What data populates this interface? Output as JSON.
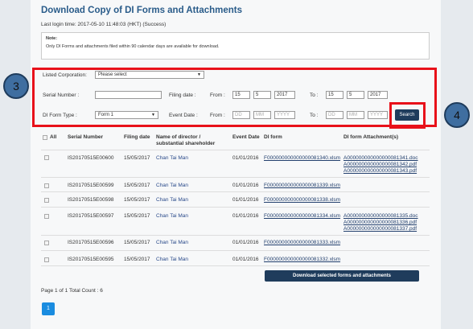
{
  "header": {
    "title": "Download Copy of DI Forms and Attachments",
    "last_login": "Last login time: 2017-05-10 11:48:03 (HKT) (Success)"
  },
  "note": {
    "label": "Note:",
    "text": "Only DI Forms and attachments filed within 90 calendar days are available for download."
  },
  "search_form": {
    "listed_corporation_label": "Listed Corporation:",
    "listed_corporation_value": "Please select",
    "serial_number_label": "Serial Number :",
    "serial_number_value": "",
    "filing_date_label": "Filing date :",
    "from_label": "From :",
    "to_label": "To :",
    "filing_from": {
      "dd": "15",
      "mm": "5",
      "yyyy": "2017"
    },
    "filing_to": {
      "dd": "15",
      "mm": "5",
      "yyyy": "2017"
    },
    "di_form_type_label": "DI Form Type :",
    "di_form_type_value": "Form 1",
    "event_date_label": "Event Date :",
    "event_from": {
      "dd": "DD",
      "mm": "MM",
      "yyyy": "YYYY"
    },
    "event_to": {
      "dd": "DD",
      "mm": "MM",
      "yyyy": "YYYY"
    },
    "search_button": "Search"
  },
  "callouts": {
    "c3": "3",
    "c4": "4"
  },
  "table": {
    "headers": {
      "all": "All",
      "serial": "Serial Number",
      "filing_date": "Filing date",
      "director": "Name of director / substantial shareholder",
      "event_date": "Event Date",
      "di_form": "DI form",
      "attachments": "DI form Attachment(s)"
    },
    "rows": [
      {
        "serial": "IS20170515E00600",
        "filing_date": "15/05/2017",
        "name": "Chan Tai Man",
        "event_date": "01/01/2016",
        "di_form": "F000000000000000081340.xlsm",
        "attachments": [
          "A000000000000000081341.doc",
          "A000000000000000081342.pdf",
          "A000000000000000081343.pdf"
        ]
      },
      {
        "serial": "IS20170515E00599",
        "filing_date": "15/05/2017",
        "name": "Chan Tai Man",
        "event_date": "01/01/2016",
        "di_form": "F000000000000000081339.xlsm",
        "attachments": []
      },
      {
        "serial": "IS20170515E00598",
        "filing_date": "15/05/2017",
        "name": "Chan Tai Man",
        "event_date": "01/01/2016",
        "di_form": "F000000000000000081338.xlsm",
        "attachments": []
      },
      {
        "serial": "IS20170515E00597",
        "filing_date": "15/05/2017",
        "name": "Chan Tai Man",
        "event_date": "01/01/2016",
        "di_form": "F000000000000000081334.xlsm",
        "attachments": [
          "A000000000000000081335.doc",
          "A000000000000000081336.pdf",
          "A000000000000000081337.pdf"
        ]
      },
      {
        "serial": "IS20170515E00596",
        "filing_date": "15/05/2017",
        "name": "Chan Tai Man",
        "event_date": "01/01/2016",
        "di_form": "F000000000000000081333.xlsm",
        "attachments": []
      },
      {
        "serial": "IS20170515E00595",
        "filing_date": "15/05/2017",
        "name": "Chan Tai Man",
        "event_date": "01/01/2016",
        "di_form": "F000000000000000081332.xlsm",
        "attachments": []
      }
    ]
  },
  "download_button": "Download selected forms and attachments",
  "pagination": {
    "info": "Page 1 of 1   Total Count : 6",
    "current_page": "1"
  },
  "colors": {
    "accent": "#1f3c5c",
    "highlight": "#e8111a",
    "page_button": "#1a8ce0"
  }
}
